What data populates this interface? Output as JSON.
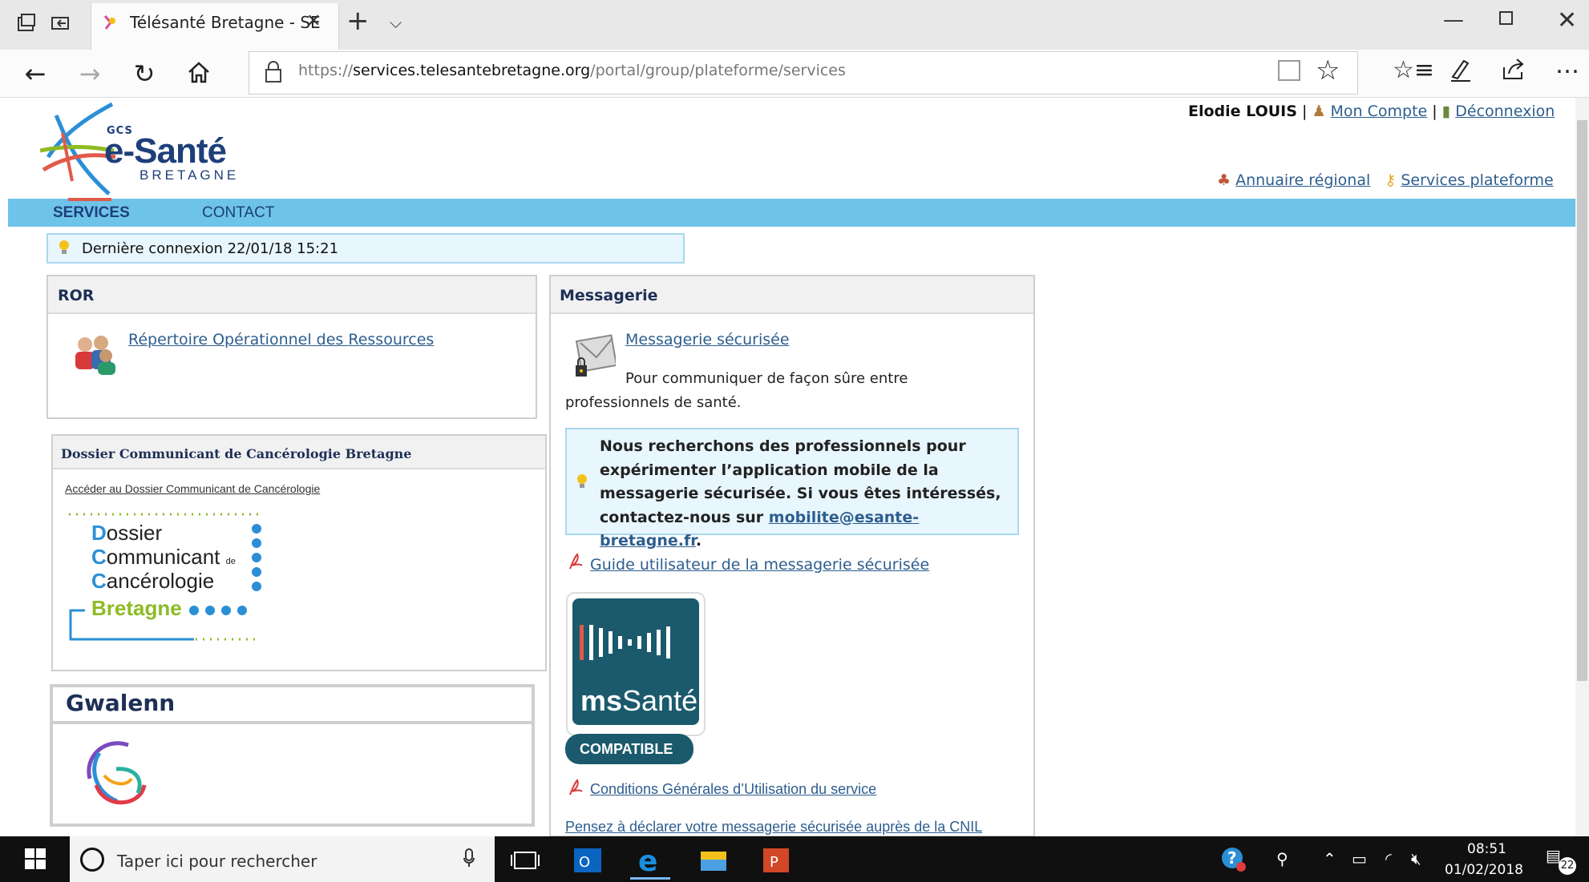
{
  "browser": {
    "tab_title": "Télésanté Bretagne - SE",
    "url_prefix": "https://",
    "url_domain": "services.telesantebretagne.org",
    "url_path": "/portal/group/plateforme/services"
  },
  "header": {
    "user_name": "Elodie LOUIS",
    "separator": "|",
    "account_label": "Mon Compte",
    "logout_label": "Déconnexion",
    "directory_label": "Annuaire régional",
    "platform_services_label": "Services plateforme",
    "logo": {
      "gcs": "GCS",
      "name": "e-Santé",
      "region": "BRETAGNE"
    }
  },
  "menu": {
    "items": [
      {
        "label": "SERVICES",
        "active": true
      },
      {
        "label": "CONTACT",
        "active": false
      }
    ]
  },
  "last_connection": "Dernière connexion 22/01/18 15:21",
  "ror": {
    "title": "ROR",
    "link": "Répertoire Opérationnel des Ressources"
  },
  "dcc": {
    "title": "Dossier Communicant de Cancérologie Bretagne",
    "link": "Accéder au Dossier Communicant de Cancérologie",
    "logo_lines": [
      {
        "cap": "D",
        "rest": "ossier"
      },
      {
        "cap": "C",
        "rest": "ommunicant",
        "suffix": "de"
      },
      {
        "cap": "C",
        "rest": "ancérologie"
      }
    ],
    "logo_region": "Bretagne"
  },
  "gwalenn": {
    "title": "Gwalenn"
  },
  "messagerie": {
    "title": "Messagerie",
    "link": "Messagerie sécurisée",
    "description": "Pour communiquer de façon sûre entre professionnels de santé.",
    "notice_text": "Nous recherchons des professionnels pour expérimenter l’application mobile de la messagerie sécurisée. Si vous êtes intéressés, contactez-nous sur",
    "notice_email": "mobilite@esante-bretagne.fr",
    "notice_end": ".",
    "guide_link": "Guide utilisateur de la messagerie sécurisée",
    "badge_name_ms": "ms",
    "badge_name_sante": "Santé",
    "badge_label": "COMPATIBLE",
    "cgu_link": "Conditions Générales d’Utilisation du service",
    "cnil_link": "Pensez à déclarer votre messagerie sécurisée auprès de la CNIL"
  },
  "taskbar": {
    "search_placeholder": "Taper ici pour rechercher",
    "time": "08:51",
    "date": "01/02/2018",
    "notifications": "22"
  },
  "colors": {
    "menu_bar": "#6ec3e9",
    "link": "#2d5e8f",
    "brand_navy": "#1d3f7a",
    "ms_badge": "#1a5a6c",
    "dcc_blue": "#2b8fd6",
    "dcc_green": "#8dbb24"
  }
}
